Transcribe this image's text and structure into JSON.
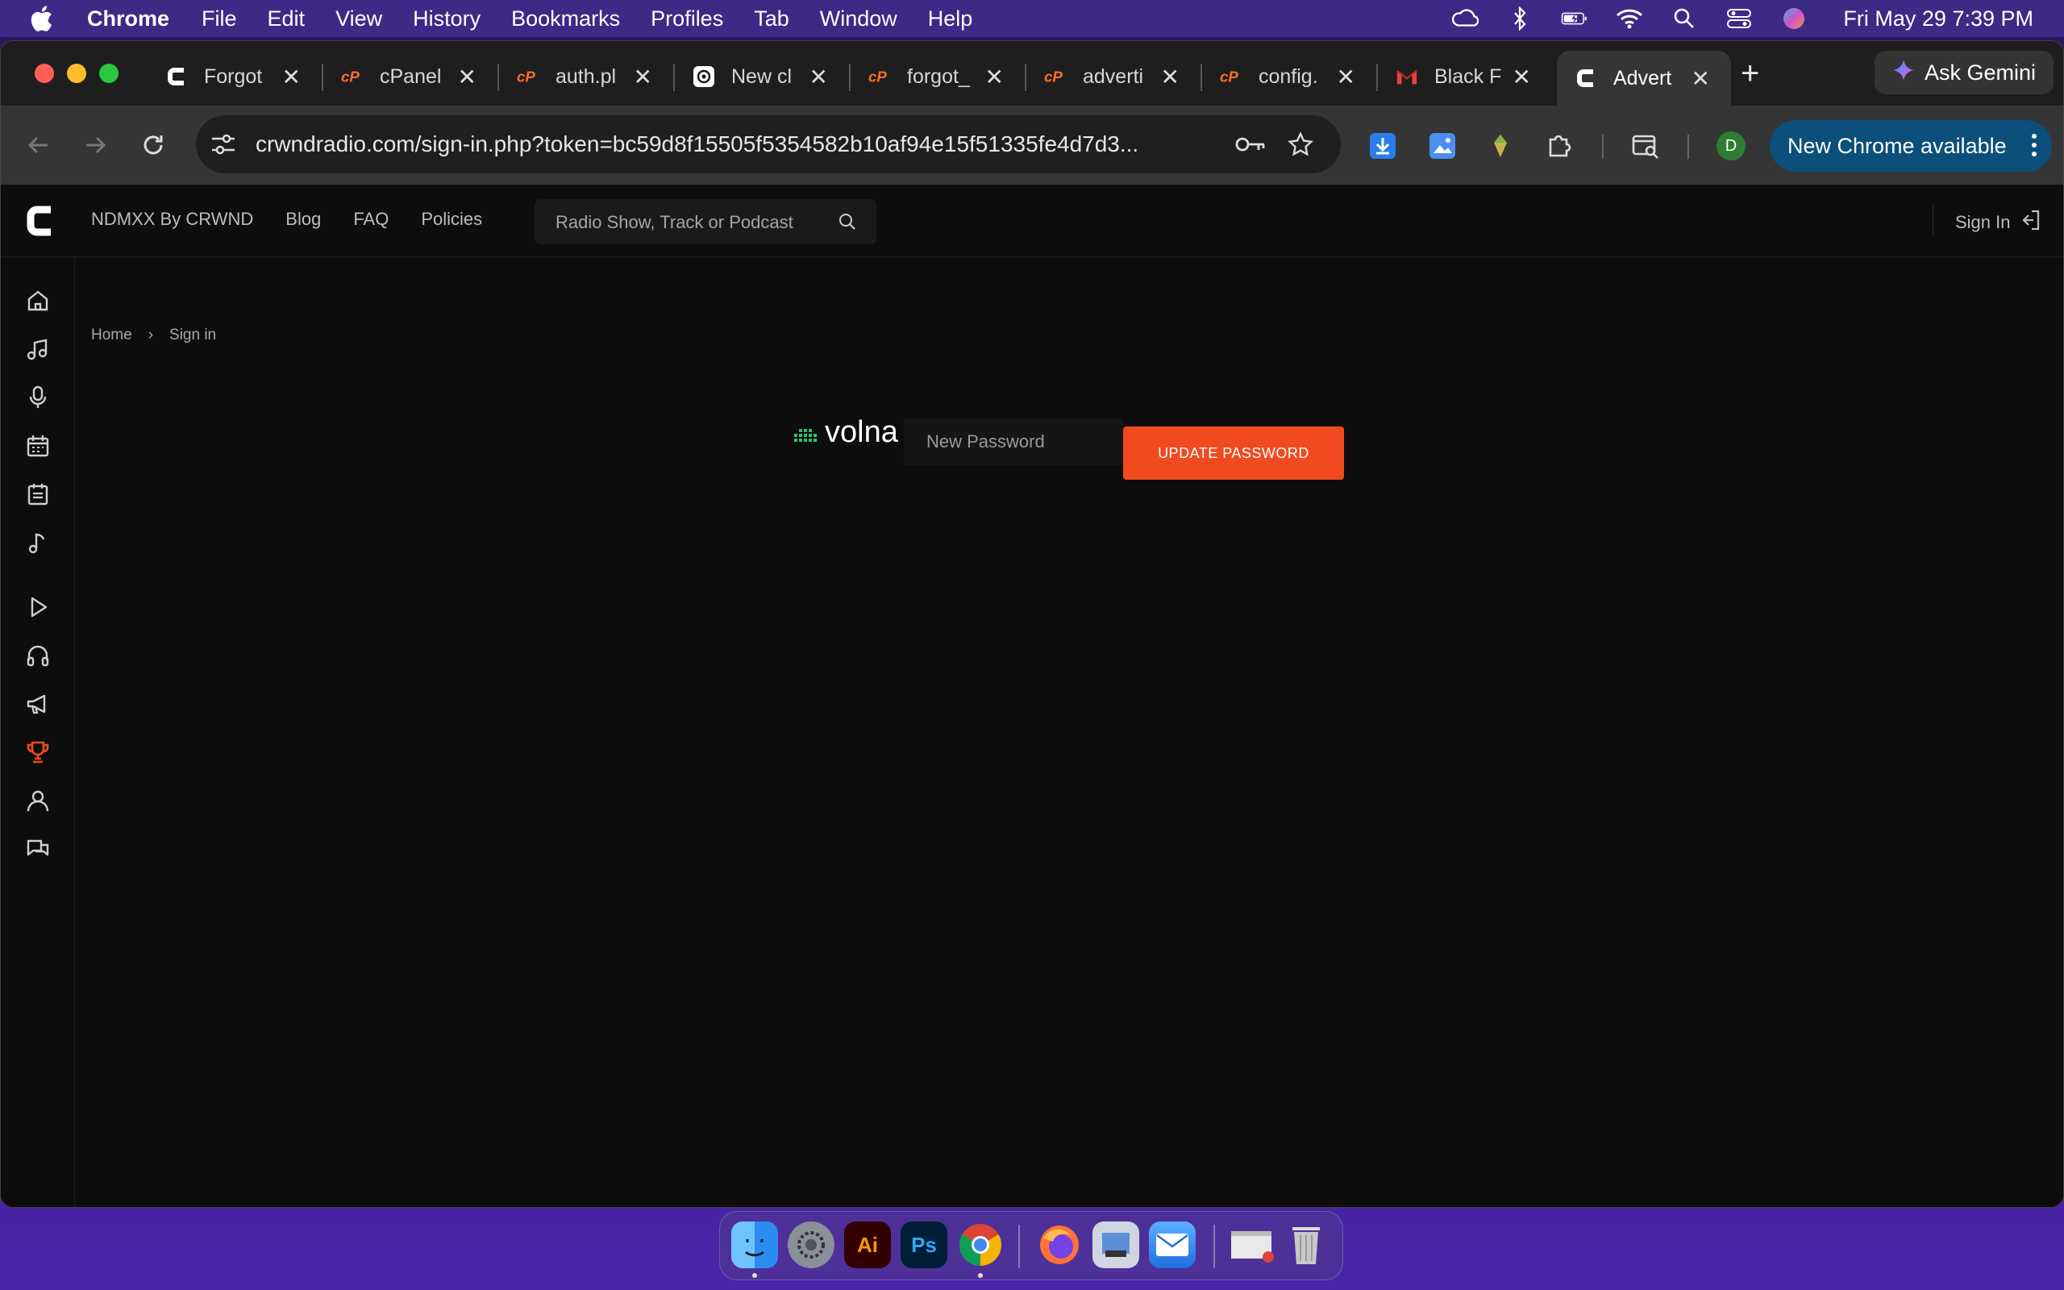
{
  "menubar": {
    "app_name": "Chrome",
    "items": [
      "File",
      "Edit",
      "View",
      "History",
      "Bookmarks",
      "Profiles",
      "Tab",
      "Window",
      "Help"
    ],
    "clock": "Fri May 29  7:39 PM"
  },
  "tabs": [
    {
      "title": "Forgot",
      "favicon": "crwnd-icon"
    },
    {
      "title": "cPanel",
      "favicon": "cpanel-icon"
    },
    {
      "title": "auth.pl",
      "favicon": "cpanel-icon"
    },
    {
      "title": "New cl",
      "favicon": "chatgpt-icon"
    },
    {
      "title": "forgot_",
      "favicon": "cpanel-icon"
    },
    {
      "title": "adverti",
      "favicon": "cpanel-icon"
    },
    {
      "title": "config.",
      "favicon": "cpanel-icon"
    },
    {
      "title": "Black F",
      "favicon": "gmail-icon"
    },
    {
      "title": "Advert",
      "favicon": "crwnd-icon",
      "active": true
    }
  ],
  "browser": {
    "ask_gemini": "Ask Gemini",
    "url": "crwndradio.com/sign-in.php?token=bc59d8f15505f5354582b10af94e15f51335fe4d7d3...",
    "profile_initial": "D",
    "update_label": "New Chrome available"
  },
  "site": {
    "nav": [
      "NDMXX By CRWND",
      "Blog",
      "FAQ",
      "Policies"
    ],
    "search_placeholder": "Radio Show, Track or Podcast",
    "signin": "Sign In",
    "breadcrumb": {
      "home": "Home",
      "separator": "›",
      "current": "Sign in"
    },
    "brand": "volna",
    "password_placeholder": "New Password",
    "update_button": "UPDATE PASSWORD"
  },
  "colors": {
    "accent": "#f04a1e",
    "brand_green": "#2fbf71",
    "active_sidebar": "#f04a1e"
  }
}
